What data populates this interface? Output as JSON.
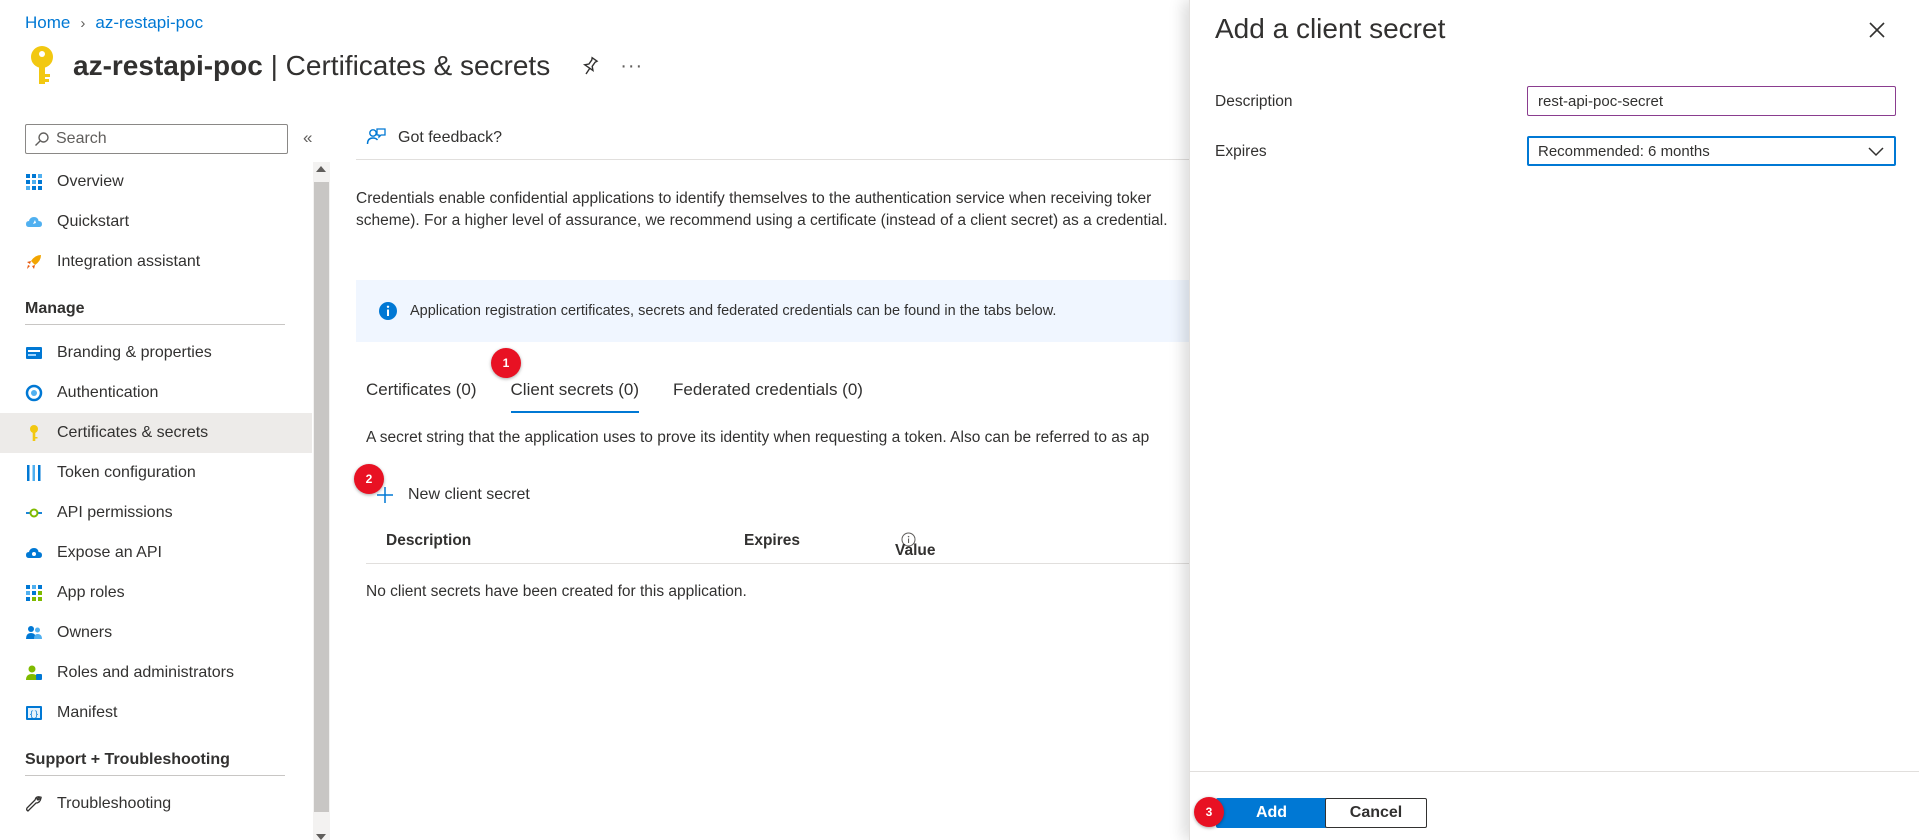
{
  "breadcrumb": {
    "home": "Home",
    "current": "az-restapi-poc"
  },
  "page": {
    "app_name": "az-restapi-poc",
    "separator": " | ",
    "title": "Certificates & secrets",
    "more": "···"
  },
  "sidebar": {
    "search_placeholder": "Search",
    "collapse": "«",
    "items_top": [
      {
        "label": "Overview",
        "icon": "grid-icon"
      },
      {
        "label": "Quickstart",
        "icon": "cloud-icon"
      },
      {
        "label": "Integration assistant",
        "icon": "rocket-icon"
      }
    ],
    "manage_heading": "Manage",
    "items_manage": [
      {
        "label": "Branding & properties",
        "icon": "branding-icon"
      },
      {
        "label": "Authentication",
        "icon": "authentication-icon"
      },
      {
        "label": "Certificates & secrets",
        "icon": "key-icon",
        "active": true
      },
      {
        "label": "Token configuration",
        "icon": "token-icon"
      },
      {
        "label": "API permissions",
        "icon": "api-permissions-icon"
      },
      {
        "label": "Expose an API",
        "icon": "cloud-api-icon"
      },
      {
        "label": "App roles",
        "icon": "app-roles-icon"
      },
      {
        "label": "Owners",
        "icon": "owners-icon"
      },
      {
        "label": "Roles and administrators",
        "icon": "roles-icon"
      },
      {
        "label": "Manifest",
        "icon": "manifest-icon"
      }
    ],
    "support_heading": "Support + Troubleshooting",
    "items_support": [
      {
        "label": "Troubleshooting",
        "icon": "wrench-icon"
      }
    ]
  },
  "toolbar": {
    "feedback": "Got feedback?"
  },
  "main": {
    "description_line1": "Credentials enable confidential applications to identify themselves to the authentication service when receiving toker",
    "description_line2": "scheme). For a higher level of assurance, we recommend using a certificate (instead of a client secret) as a credential.",
    "info_banner": "Application registration certificates, secrets and federated credentials can be found in the tabs below.",
    "tabs": [
      {
        "label": "Certificates (0)"
      },
      {
        "label": "Client secrets (0)",
        "active": true
      },
      {
        "label": "Federated credentials (0)"
      }
    ],
    "tab_description": "A secret string that the application uses to prove its identity when requesting a token. Also can be referred to as ap",
    "new_secret_label": "New client secret",
    "table_headers": {
      "description": "Description",
      "expires": "Expires",
      "value": "Value"
    },
    "empty_message": "No client secrets have been created for this application."
  },
  "badges": {
    "one": "1",
    "two": "2",
    "three": "3"
  },
  "panel": {
    "title": "Add a client secret",
    "description_label": "Description",
    "description_value": "rest-api-poc-secret",
    "expires_label": "Expires",
    "expires_value": "Recommended: 6 months",
    "add_label": "Add",
    "cancel_label": "Cancel"
  },
  "colors": {
    "accent": "#0078d4",
    "badge": "#e81123",
    "key": "#f2c811",
    "active_bg": "#edebe9"
  }
}
